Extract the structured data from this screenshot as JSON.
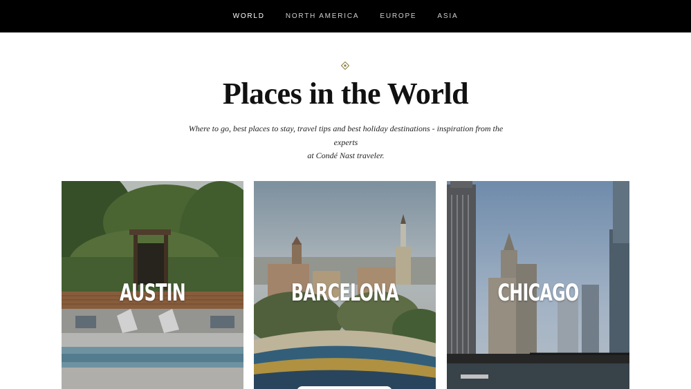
{
  "nav": {
    "items": [
      {
        "label": "WORLD"
      },
      {
        "label": "NORTH AMERICA"
      },
      {
        "label": "EUROPE"
      },
      {
        "label": "ASIA"
      }
    ]
  },
  "header": {
    "ornament_icon": "diamond-ornament-icon",
    "title": "Places in the World",
    "subtitle_line1": "Where to go, best places to stay, travel tips and best holiday destinations - inspiration from the experts",
    "subtitle_line2": "at Condé Nast traveler."
  },
  "cards": [
    {
      "label": "AUSTIN"
    },
    {
      "label": "BARCELONA"
    },
    {
      "label": "CHICAGO"
    }
  ],
  "colors": {
    "nav_bg": "#000000",
    "ornament": "#8a7a3a"
  }
}
